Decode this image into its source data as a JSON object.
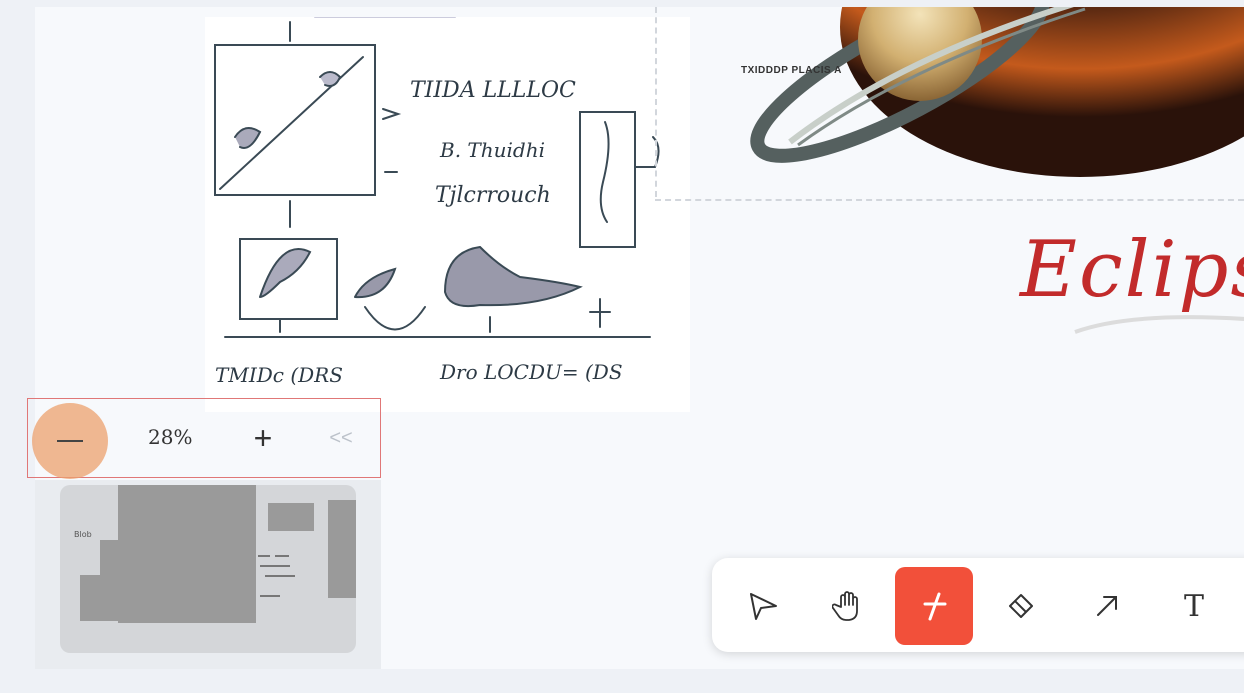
{
  "canvas": {
    "sketch_handwriting": [
      "TIIDA LLLLOC",
      "B. Thuidhi",
      "Tjlcrrouch",
      "TMIDc (DRS",
      "Dro LOCDU= (DS"
    ],
    "saturn_caption": "TXIDDDP PLACIS A",
    "eclipse_text": "Eclips"
  },
  "zoom": {
    "zoom_out_icon": "minus-icon",
    "level": "28%",
    "zoom_in_label": "+",
    "collapse_label": "<<"
  },
  "minimap": {
    "label": "Blob"
  },
  "toolbar": {
    "tools": [
      {
        "icon": "select-arrow-icon",
        "active": false
      },
      {
        "icon": "hand-icon",
        "active": false
      },
      {
        "icon": "pen-icon",
        "active": true
      },
      {
        "icon": "eraser-icon",
        "active": false
      },
      {
        "icon": "arrow-icon",
        "active": false
      },
      {
        "icon": "text-icon",
        "label": "T",
        "active": false
      }
    ],
    "accent_color": "#f2503a"
  }
}
